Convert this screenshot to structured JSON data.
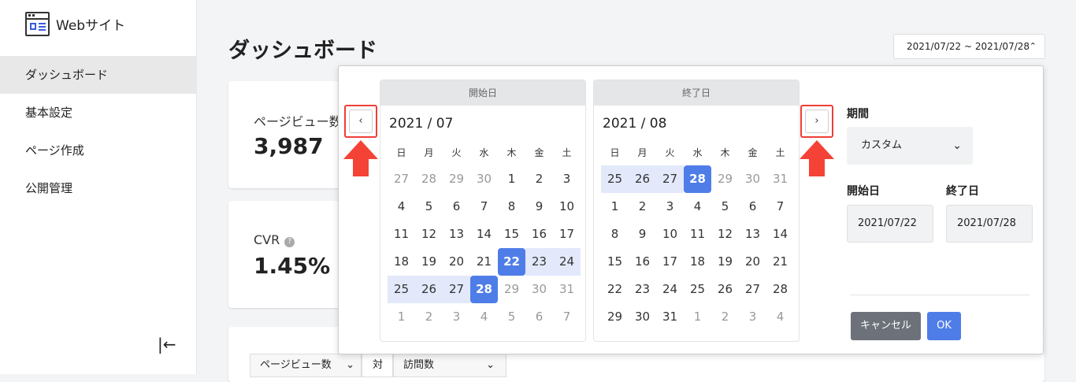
{
  "sidebar": {
    "brand": "Webサイト",
    "items": [
      {
        "label": "ダッシュボード",
        "active": true
      },
      {
        "label": "基本設定"
      },
      {
        "label": "ページ作成"
      },
      {
        "label": "公開管理"
      }
    ],
    "collapse_icon": "collapse-left-icon",
    "collapse_glyph": "|←"
  },
  "header": {
    "title": "ダッシュボード",
    "range": "2021/07/22 ~ 2021/07/28",
    "range_chevron": "⌃"
  },
  "cards": [
    {
      "label": "ページビュー数",
      "value": "3,987"
    },
    {
      "label": "CVR",
      "value": "1.45%",
      "help": "?"
    }
  ],
  "filters": {
    "left_select": "ページビュー数",
    "vs": "対",
    "right_select": "訪問数",
    "chevron": "⌄"
  },
  "datepicker": {
    "prev": "‹",
    "next": "›",
    "weekdays": [
      "日",
      "月",
      "火",
      "水",
      "木",
      "金",
      "土"
    ],
    "start": {
      "header": "開始日",
      "month": "2021 / 07",
      "weeks": [
        [
          "27",
          "28",
          "29",
          "30",
          "1",
          "2",
          "3"
        ],
        [
          "4",
          "5",
          "6",
          "7",
          "8",
          "9",
          "10"
        ],
        [
          "11",
          "12",
          "13",
          "14",
          "15",
          "16",
          "17"
        ],
        [
          "18",
          "19",
          "20",
          "21",
          "22",
          "23",
          "24"
        ],
        [
          "25",
          "26",
          "27",
          "28",
          "29",
          "30",
          "31"
        ],
        [
          "1",
          "2",
          "3",
          "4",
          "5",
          "6",
          "7"
        ]
      ]
    },
    "end": {
      "header": "終了日",
      "month": "2021 / 08",
      "weeks": [
        [
          "25",
          "26",
          "27",
          "28",
          "29",
          "30",
          "31"
        ],
        [
          "1",
          "2",
          "3",
          "4",
          "5",
          "6",
          "7"
        ],
        [
          "8",
          "9",
          "10",
          "11",
          "12",
          "13",
          "14"
        ],
        [
          "15",
          "16",
          "17",
          "18",
          "19",
          "20",
          "21"
        ],
        [
          "22",
          "23",
          "24",
          "25",
          "26",
          "27",
          "28"
        ],
        [
          "29",
          "30",
          "31",
          "1",
          "2",
          "3",
          "4"
        ]
      ]
    },
    "period_label": "期間",
    "period_value": "カスタム",
    "start_label": "開始日",
    "start_value": "2021/07/22",
    "end_label": "終了日",
    "end_value": "2021/07/28",
    "cancel": "キャンセル",
    "ok": "OK",
    "highlight_color": "#ef3e36",
    "selected_color": "#4f7de8",
    "range_color": "#e3e9fb"
  }
}
